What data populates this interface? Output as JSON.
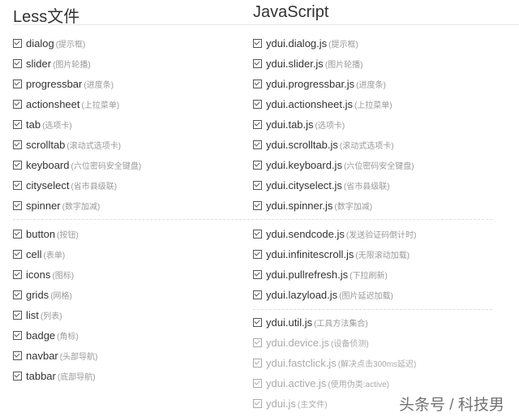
{
  "less": {
    "title": "Less文件",
    "group1": [
      {
        "name": "dialog",
        "note": "(提示框)"
      },
      {
        "name": "slider",
        "note": "(图片轮播)"
      },
      {
        "name": "progressbar",
        "note": "(进度条)"
      },
      {
        "name": "actionsheet",
        "note": "(上拉菜单)"
      },
      {
        "name": "tab",
        "note": "(选项卡)"
      },
      {
        "name": "scrolltab",
        "note": "(滚动式选项卡)"
      },
      {
        "name": "keyboard",
        "note": "(六位密码安全键盘)"
      },
      {
        "name": "cityselect",
        "note": "(省市县级联)"
      },
      {
        "name": "spinner",
        "note": "(数字加减)"
      }
    ],
    "group2": [
      {
        "name": "button",
        "note": "(按钮)"
      },
      {
        "name": "cell",
        "note": "(表单)"
      },
      {
        "name": "icons",
        "note": "(图标)"
      },
      {
        "name": "grids",
        "note": "(网格)"
      },
      {
        "name": "list",
        "note": "(列表)"
      },
      {
        "name": "badge",
        "note": "(角标)"
      },
      {
        "name": "navbar",
        "note": "(头部导航)"
      },
      {
        "name": "tabbar",
        "note": "(底部导航)"
      }
    ]
  },
  "js": {
    "title": "JavaScript",
    "group1": [
      {
        "name": "ydui.dialog.js",
        "note": "(提示框)"
      },
      {
        "name": "ydui.slider.js",
        "note": "(图片轮播)"
      },
      {
        "name": "ydui.progressbar.js",
        "note": "(进度条)"
      },
      {
        "name": "ydui.actionsheet.js",
        "note": "(上拉菜单)"
      },
      {
        "name": "ydui.tab.js",
        "note": "(选项卡)"
      },
      {
        "name": "ydui.scrolltab.js",
        "note": "(滚动式选项卡)"
      },
      {
        "name": "ydui.keyboard.js",
        "note": "(六位密码安全键盘)"
      },
      {
        "name": "ydui.cityselect.js",
        "note": "(省市县级联)"
      },
      {
        "name": "ydui.spinner.js",
        "note": "(数字加减)"
      }
    ],
    "group2": [
      {
        "name": "ydui.sendcode.js",
        "note": "(发送验证码倒计时)"
      },
      {
        "name": "ydui.infinitescroll.js",
        "note": "(无限滚动加载)"
      },
      {
        "name": "ydui.pullrefresh.js",
        "note": "(下拉刷新)"
      },
      {
        "name": "ydui.lazyload.js",
        "note": "(图片延迟加载)"
      }
    ],
    "group3": [
      {
        "name": "ydui.util.js",
        "note": "(工具方法集合)",
        "dim": false
      },
      {
        "name": "ydui.device.js",
        "note": "(设备侦测)",
        "dim": true
      },
      {
        "name": "ydui.fastclick.js",
        "note": "(解决点击300ms延迟)",
        "dim": true
      },
      {
        "name": "ydui.active.js",
        "note": "(使用伪类:active)",
        "dim": true
      },
      {
        "name": "ydui.js",
        "note": "(主文件)",
        "dim": true
      }
    ]
  },
  "watermark": "头条号 / 科技男"
}
